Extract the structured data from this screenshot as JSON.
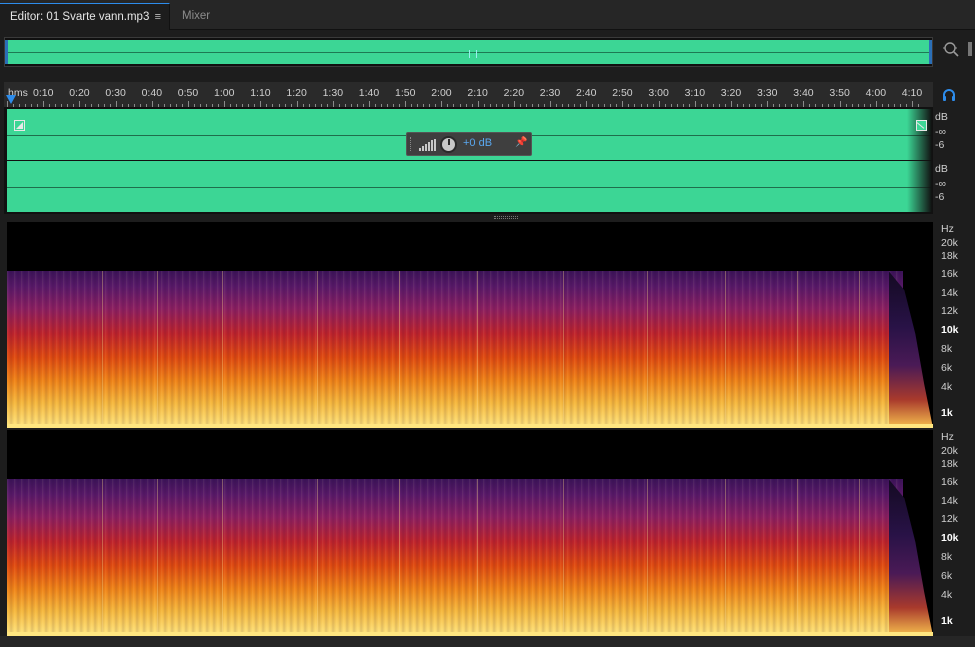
{
  "tabs": {
    "editor_label": "Editor: 01 Svarte vann.mp3",
    "editor_menu": "≡",
    "mixer_label": "Mixer"
  },
  "toolbar": {
    "zoom_icon": "zoom-icon"
  },
  "ruler": {
    "unit": "hms",
    "labels": [
      "0:10",
      "0:20",
      "0:30",
      "0:40",
      "0:50",
      "1:00",
      "1:10",
      "1:20",
      "1:30",
      "1:40",
      "1:50",
      "2:00",
      "2:10",
      "2:20",
      "2:30",
      "2:40",
      "2:50",
      "3:00",
      "3:10",
      "3:20",
      "3:30",
      "3:40",
      "3:50",
      "4:00",
      "4:10"
    ]
  },
  "hud": {
    "gain": "+0 dB"
  },
  "amplitude_scale": {
    "channel_1": [
      "dB",
      "-∞",
      "-6"
    ],
    "channel_2": [
      "dB",
      "-∞",
      "-6"
    ]
  },
  "frequency_scale": {
    "unit": "Hz",
    "labels": [
      "20k",
      "18k",
      "16k",
      "14k",
      "12k",
      "10k",
      "8k",
      "6k",
      "4k",
      "1k"
    ]
  },
  "colors": {
    "waveform": "#3cd695",
    "accent": "#2d8ceb",
    "background": "#1d1d1d"
  }
}
